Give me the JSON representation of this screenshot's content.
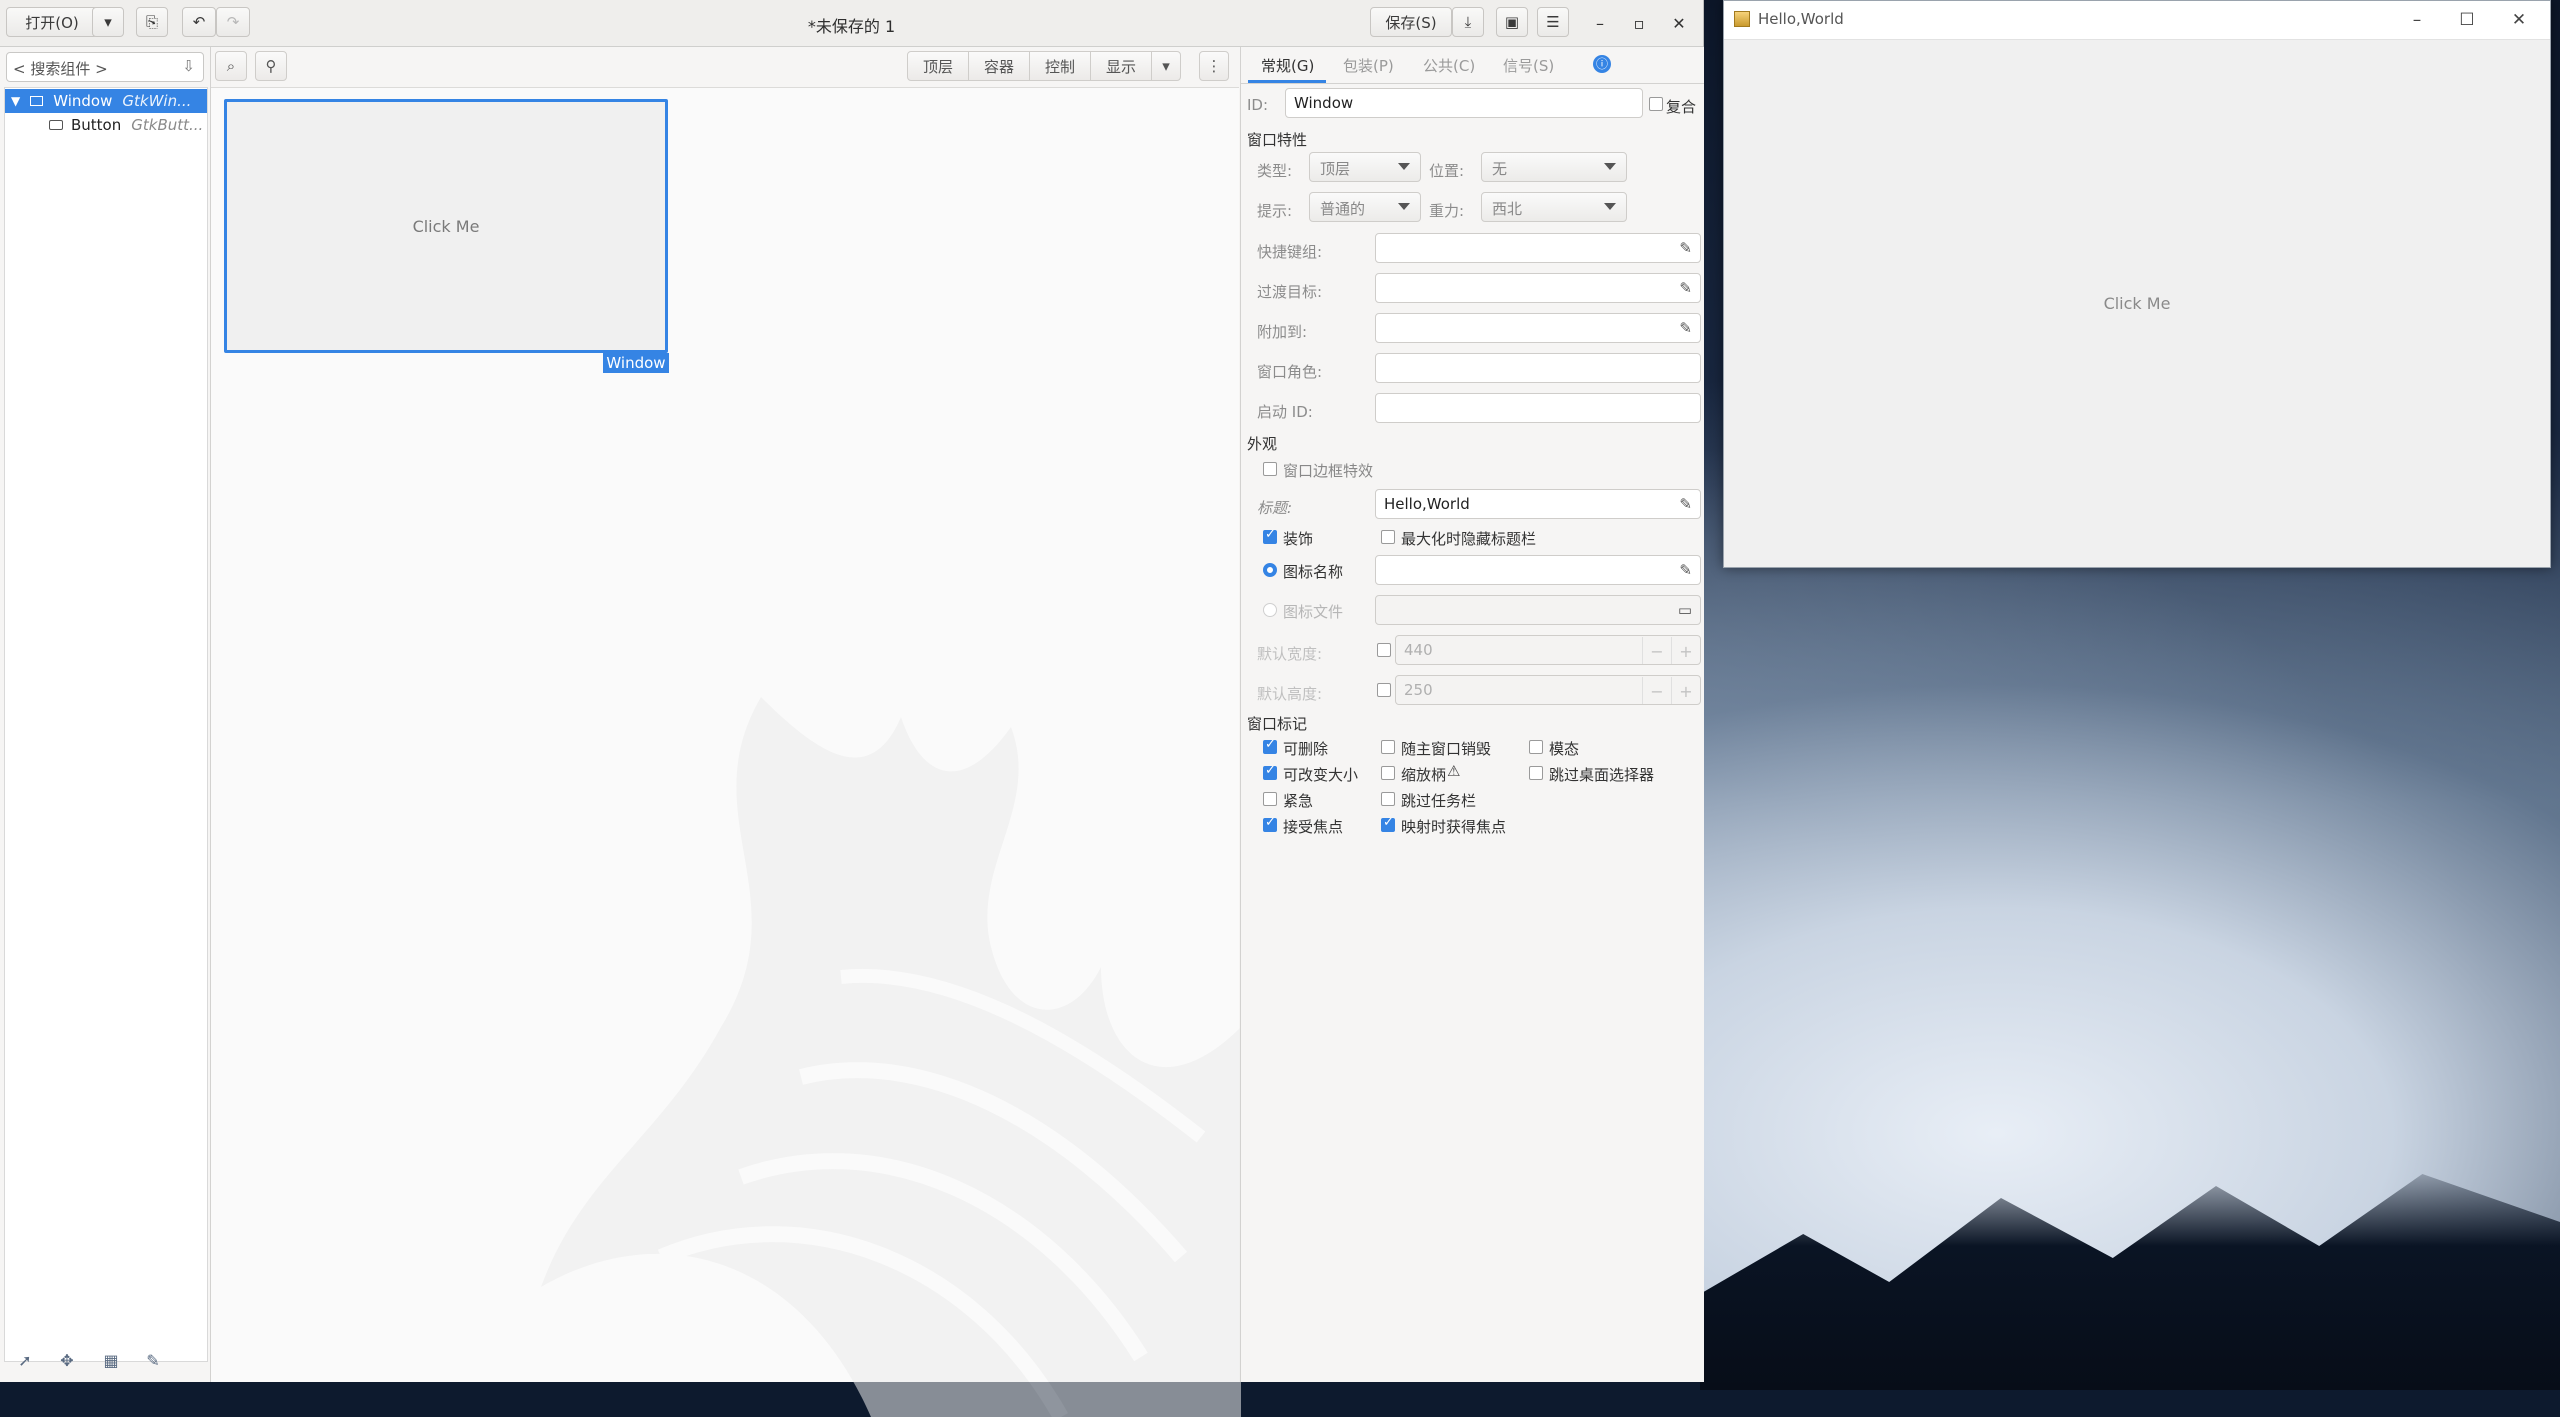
{
  "headerbar": {
    "open_label": "打开(O)",
    "title": "*未保存的 1",
    "save_label": "保存(S)"
  },
  "left": {
    "search_placeholder": "< 搜索组件 >",
    "tree": [
      {
        "name": "Window",
        "class": "GtkWin..."
      },
      {
        "name": "Button",
        "class": "GtkButt..."
      }
    ]
  },
  "center": {
    "toolbar": [
      "顶层",
      "容器",
      "控制",
      "显示"
    ],
    "canvas_button_label": "Click Me",
    "canvas_window_tag": "Window"
  },
  "right": {
    "tabs": [
      "常规(G)",
      "包装(P)",
      "公共(C)",
      "信号(S)"
    ],
    "id_label": "ID:",
    "id_value": "Window",
    "composite_label": "复合",
    "section_window_props": "窗口特性",
    "type_label": "类型:",
    "type_value": "顶层",
    "position_label": "位置:",
    "position_value": "无",
    "hint_label": "提示:",
    "hint_value": "普通的",
    "gravity_label": "重力:",
    "gravity_value": "西北",
    "accel_label": "快捷键组:",
    "transient_label": "过渡目标:",
    "attached_label": "附加到:",
    "role_label": "窗口角色:",
    "startup_label": "启动 ID:",
    "section_appearance": "外观",
    "border_effect_label": "窗口边框特效",
    "title_label": "标题:",
    "title_value": "Hello,World",
    "decorated_label": "装饰",
    "hide_titlebar_label": "最大化时隐藏标题栏",
    "icon_name_label": "图标名称",
    "icon_file_label": "图标文件",
    "default_width_label": "默认宽度:",
    "default_width_value": "440",
    "default_height_label": "默认高度:",
    "default_height_value": "250",
    "section_flags": "窗口标记",
    "flags": {
      "deletable": "可删除",
      "destroy_with_parent": "随主窗口销毁",
      "modal": "模态",
      "resizable": "可改变大小",
      "resize_grip": "缩放柄",
      "skip_pager": "跳过桌面选择器",
      "urgent": "紧急",
      "skip_taskbar": "跳过任务栏",
      "accept_focus": "接受焦点",
      "focus_on_map": "映射时获得焦点"
    }
  },
  "hello_window": {
    "title": "Hello,World",
    "button_label": "Click Me"
  },
  "colors": {
    "accent": "#3584e4",
    "panel_bg": "#f6f5f4"
  }
}
